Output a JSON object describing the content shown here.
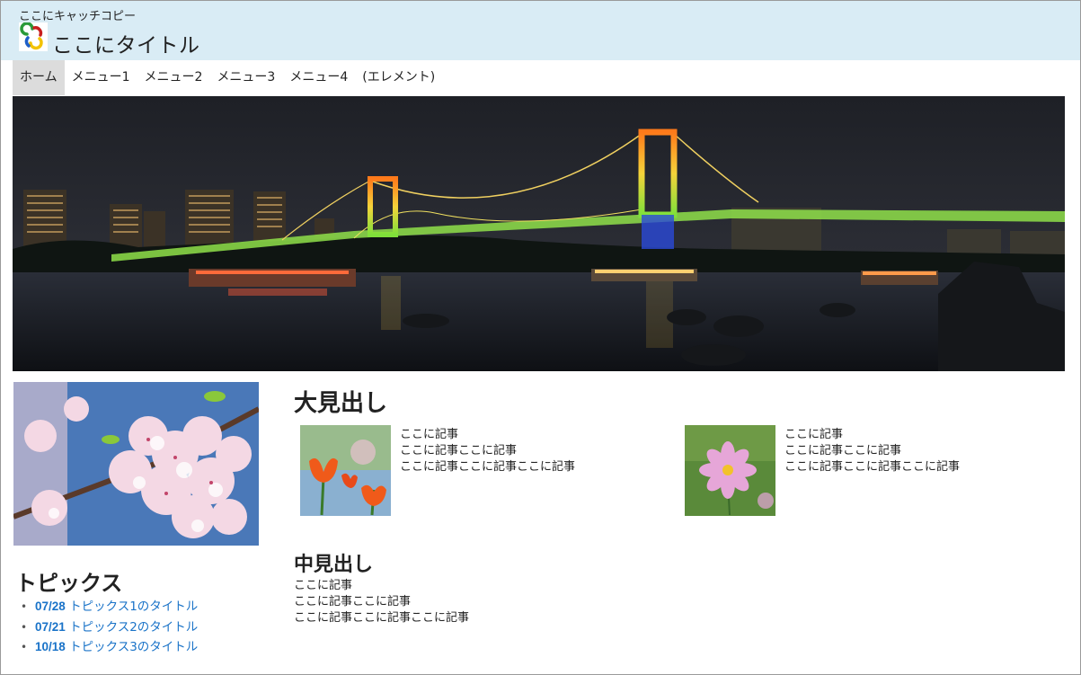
{
  "header": {
    "catch_copy": "ここにキャッチコピー",
    "title": "ここにタイトル",
    "background": "#d9ecf5"
  },
  "nav": {
    "items": [
      {
        "label": "ホーム"
      },
      {
        "label": "メニュー1"
      },
      {
        "label": "メニュー2"
      },
      {
        "label": "メニュー3"
      },
      {
        "label": "メニュー4"
      },
      {
        "label": "(エレメント)"
      }
    ],
    "active_index": 0
  },
  "images": {
    "hero": "night-bridge-cityscape",
    "sidebar": "cherry-blossom-photo",
    "thumb_1": "tulip-photo",
    "thumb_2": "cosmos-flower-photo"
  },
  "sidebar": {
    "topics_heading": "トピックス",
    "topics": [
      {
        "date": "07/28",
        "title": "トピックス1のタイトル"
      },
      {
        "date": "07/21",
        "title": "トピックス2のタイトル"
      },
      {
        "date": "10/18",
        "title": "トピックス3のタイトル"
      }
    ]
  },
  "main": {
    "large_heading": "大見出し",
    "articles": [
      {
        "lines": [
          "ここに記事",
          "ここに記事ここに記事",
          "ここに記事ここに記事ここに記事"
        ]
      },
      {
        "lines": [
          "ここに記事",
          "ここに記事ここに記事",
          "ここに記事ここに記事ここに記事"
        ]
      }
    ],
    "medium_heading": "中見出し",
    "body_lines": [
      "ここに記事",
      "ここに記事ここに記事",
      "ここに記事ここに記事ここに記事"
    ]
  },
  "colors": {
    "link": "#1a73c8",
    "nav_active": "#dcdcdc"
  }
}
